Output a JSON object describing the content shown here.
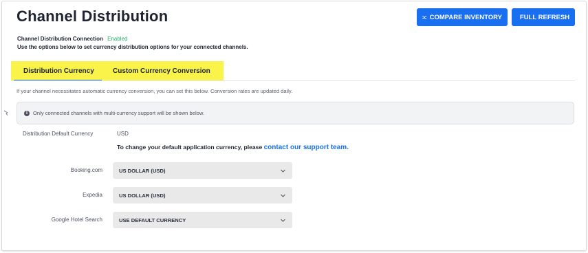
{
  "page": {
    "title": "Channel Distribution"
  },
  "actions": {
    "compare_label": "COMPARE INVENTORY",
    "refresh_label": "FULL REFRESH",
    "brand_color": "#1a6ff0"
  },
  "connection": {
    "label": "Channel Distribution Connection",
    "status": "Enabled",
    "status_color": "#24b06a",
    "description": "Use the options below to set currency distribution options for your connected channels."
  },
  "tabs": [
    {
      "label": "Distribution Currency",
      "active": true
    },
    {
      "label": "Custom Currency Conversion",
      "active": false
    }
  ],
  "info_text": "If your channel necessitates automatic currency conversion, you can set this below. Conversion rates are updated daily.",
  "notice": {
    "icon": "info-circle-icon",
    "text": "Only connected channels with multi-currency support will be shown below."
  },
  "default_currency": {
    "label": "Distribution Default Currency",
    "value": "USD",
    "note_text": "To change your default application currency, please ",
    "link_text": "contact our support team."
  },
  "channels": [
    {
      "name": "Booking.com",
      "selected": "US DOLLAR (USD)"
    },
    {
      "name": "Expedia",
      "selected": "US DOLLAR (USD)"
    },
    {
      "name": "Google Hotel Search",
      "selected": "USE DEFAULT CURRENCY"
    }
  ]
}
